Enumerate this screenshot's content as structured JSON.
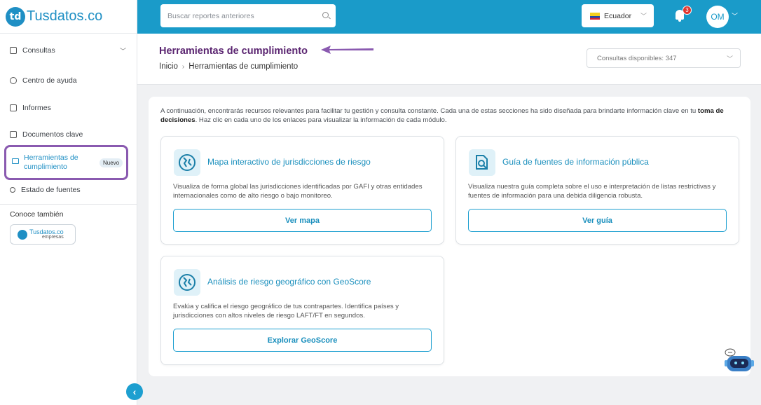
{
  "brand": {
    "logo_letters": "td",
    "name": "Tusdatos.co"
  },
  "sidebar": {
    "items": [
      {
        "label": "Consultas"
      },
      {
        "label": "Centro de ayuda"
      },
      {
        "label": "Informes"
      },
      {
        "label": "Documentos clave"
      },
      {
        "label": "Herramientas de cumplimiento",
        "badge": "Nuevo",
        "active": true
      },
      {
        "label": "Estado de fuentes"
      }
    ],
    "also_title": "Conoce también",
    "empresas_label": "Tusdatos.co",
    "empresas_sub": "empresas",
    "collapse_icon": "‹"
  },
  "topbar": {
    "search_placeholder": "Buscar reportes anteriores",
    "country": "Ecuador",
    "notifications_count": "3",
    "user_initials": "OM"
  },
  "header": {
    "title": "Herramientas de cumplimiento",
    "breadcrumb_home": "Inicio",
    "breadcrumb_current": "Herramientas de cumplimiento",
    "consultas_label": "Consultas disponibles: 347"
  },
  "main": {
    "intro_part1": "A continuación, encontrarás recursos relevantes para facilitar tu gestión y consulta constante. Cada una de estas secciones ha sido diseñada para brindarte información clave en tu ",
    "intro_bold": "toma de decisiones",
    "intro_part2": ". Haz clic en cada uno de los enlaces para visualizar la información de cada módulo.",
    "tools": [
      {
        "icon": "globe-icon",
        "title": "Mapa interactivo de jurisdicciones de riesgo",
        "description": "Visualiza de forma global las jurisdicciones identificadas por GAFI y otras entidades internacionales como de alto riesgo o bajo monitoreo.",
        "button": "Ver mapa"
      },
      {
        "icon": "document-search-icon",
        "title": "Guía de fuentes de información pública",
        "description": "Visualiza nuestra guía completa sobre el uso e interpretación de listas restrictivas y fuentes de información para una debida diligencia robusta.",
        "button": "Ver guía"
      },
      {
        "icon": "globe-icon",
        "title": "Análisis de riesgo geográfico con GeoScore",
        "description": "Evalúa y califica el riesgo geográfico de tus contrapartes. Identifica países y jurisdicciones con altos niveles de riesgo LAFT/FT en segundos.",
        "button": "Explorar GeoScore"
      }
    ]
  },
  "colors": {
    "topbar": "#1a9bc9",
    "title_purple": "#5a2470",
    "highlight_purple": "#8a5ab0",
    "accent_blue": "#1a8fbd"
  }
}
